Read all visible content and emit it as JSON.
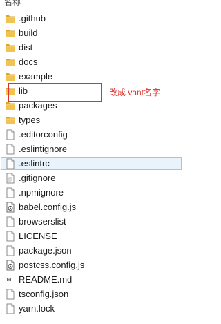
{
  "header": {
    "column_name": "名称"
  },
  "files": [
    {
      "name": ".github",
      "type": "folder",
      "icon": "folder-icon"
    },
    {
      "name": "build",
      "type": "folder",
      "icon": "folder-icon"
    },
    {
      "name": "dist",
      "type": "folder",
      "icon": "folder-icon"
    },
    {
      "name": "docs",
      "type": "folder",
      "icon": "folder-icon"
    },
    {
      "name": "example",
      "type": "folder",
      "icon": "folder-icon"
    },
    {
      "name": "lib",
      "type": "folder",
      "icon": "folder-icon"
    },
    {
      "name": "packages",
      "type": "folder",
      "icon": "folder-icon"
    },
    {
      "name": "types",
      "type": "folder",
      "icon": "folder-icon"
    },
    {
      "name": ".editorconfig",
      "type": "file",
      "icon": "file-icon"
    },
    {
      "name": ".eslintignore",
      "type": "file",
      "icon": "file-icon"
    },
    {
      "name": ".eslintrc",
      "type": "file",
      "icon": "file-icon",
      "selected": true
    },
    {
      "name": ".gitignore",
      "type": "file",
      "icon": "text-file-icon"
    },
    {
      "name": ".npmignore",
      "type": "file",
      "icon": "file-icon"
    },
    {
      "name": "babel.config.js",
      "type": "file",
      "icon": "script-file-icon"
    },
    {
      "name": "browserslist",
      "type": "file",
      "icon": "file-icon"
    },
    {
      "name": "LICENSE",
      "type": "file",
      "icon": "file-icon"
    },
    {
      "name": "package.json",
      "type": "file",
      "icon": "file-icon"
    },
    {
      "name": "postcss.config.js",
      "type": "file",
      "icon": "script-file-icon"
    },
    {
      "name": "README.md",
      "type": "file",
      "icon": "markdown-file-icon"
    },
    {
      "name": "tsconfig.json",
      "type": "file",
      "icon": "file-icon"
    },
    {
      "name": "yarn.lock",
      "type": "file",
      "icon": "file-icon"
    }
  ],
  "annotation": {
    "target": "lib",
    "text": "改成 vant名字",
    "color": "#e0302a"
  },
  "colors": {
    "folder": "#e8b63c",
    "selection_bg": "#e9f3fc",
    "selection_border": "#9ac6ef"
  }
}
